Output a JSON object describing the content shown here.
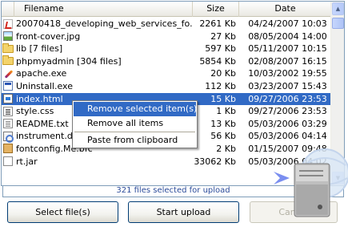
{
  "header": {
    "filename_label": "Filename",
    "size_label": "Size",
    "date_label": "Date"
  },
  "files": [
    {
      "icon": "pdf-icon",
      "name": "20070418_developing_web_services_fo...",
      "size": "2261 Kb",
      "date": "04/24/2007 10:03"
    },
    {
      "icon": "image-icon",
      "name": "front-cover.jpg",
      "size": "27 Kb",
      "date": "08/05/2004 14:00"
    },
    {
      "icon": "folder-icon",
      "name": "lib [7 files]",
      "size": "597 Kb",
      "date": "05/11/2007 10:15"
    },
    {
      "icon": "folder-icon",
      "name": "phpmyadmin [304 files]",
      "size": "5854 Kb",
      "date": "02/08/2007 16:15"
    },
    {
      "icon": "feather-icon",
      "name": "apache.exe",
      "size": "20 Kb",
      "date": "10/03/2002 19:55"
    },
    {
      "icon": "exe-icon",
      "name": "Uninstall.exe",
      "size": "112 Kb",
      "date": "03/23/2007 15:43"
    },
    {
      "icon": "html-icon",
      "name": "index.html",
      "size": "15 Kb",
      "date": "09/27/2006 23:53"
    },
    {
      "icon": "css-icon",
      "name": "style.css",
      "size": "1 Kb",
      "date": "09/27/2006 23:53"
    },
    {
      "icon": "text-icon",
      "name": "README.txt",
      "size": "13 Kb",
      "date": "05/03/2006 03:29"
    },
    {
      "icon": "dll-icon",
      "name": "instrument.dll",
      "size": "56 Kb",
      "date": "05/03/2006 04:14"
    },
    {
      "icon": "config-icon",
      "name": "fontconfig.Me.bfc",
      "size": "2 Kb",
      "date": "01/15/2007 09:48"
    },
    {
      "icon": "jar-icon",
      "name": "rt.jar",
      "size": "33062 Kb",
      "date": "05/03/2006 04:02"
    }
  ],
  "selected_row": 6,
  "context_menu": {
    "remove_selected": "Remove selected item(s)",
    "remove_all": "Remove all items",
    "paste": "Paste from clipboard"
  },
  "status": {
    "text": "321 files selected for upload"
  },
  "buttons": {
    "select_files": "Select file(s)",
    "start_upload": "Start upload",
    "cancel": "Cancel"
  },
  "colors": {
    "selection": "#316ac5",
    "border": "#7f9db9",
    "status_text": "#2b4b9a"
  }
}
